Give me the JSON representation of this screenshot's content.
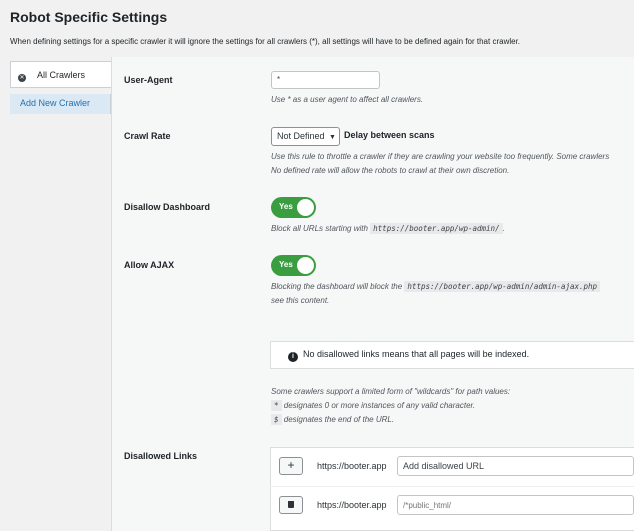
{
  "header": {
    "title": "Robot Specific Settings",
    "description": "When defining settings for a specific crawler it will ignore the settings for all crawlers (*), all settings will have to be defined again for that crawler."
  },
  "sidebar": {
    "items": [
      {
        "label": "All Crawlers",
        "active": true,
        "icon": "close-circle-icon"
      },
      {
        "label": "Add New Crawler",
        "active": false
      }
    ]
  },
  "user_agent": {
    "label": "User-Agent",
    "value": "*",
    "help": "Use * as a user agent to affect all crawlers."
  },
  "crawl_rate": {
    "label": "Crawl Rate",
    "selected": "Not Defined",
    "suffix": "Delay between scans",
    "help_line1": "Use this rule to throttle a crawler if they are crawling your website too frequently. Some crawlers",
    "help_line2": "No defined rate will allow the robots to crawl at their own discretion."
  },
  "disallow_dashboard": {
    "label": "Disallow Dashboard",
    "toggle": "Yes",
    "help_prefix": "Block all URLs starting with",
    "help_code": "https://booter.app/wp-admin/",
    "help_suffix": "."
  },
  "allow_ajax": {
    "label": "Allow AJAX",
    "toggle": "Yes",
    "help_prefix": "Blocking the dashboard will block the",
    "help_code": "https://booter.app/wp-admin/admin-ajax.php",
    "help_line2": "see this content."
  },
  "notice": {
    "text": "No disallowed links means that all pages will be indexed."
  },
  "wildcards": {
    "intro": "Some crawlers support a limited form of \"wildcards\" for path values:",
    "items": [
      {
        "symbol": "*",
        "text": "designates 0 or more instances of any valid character."
      },
      {
        "symbol": "$",
        "text": "designates the end of the URL."
      }
    ]
  },
  "disallowed_links": {
    "label": "Disallowed Links",
    "rows": [
      {
        "button": "+",
        "button_icon": "plus-icon",
        "prefix": "https://booter.app",
        "value": "Add disallowed URL",
        "is_placeholder": false
      },
      {
        "button": "🗑",
        "button_icon": "trash-icon",
        "prefix": "https://booter.app",
        "placeholder": "/*public_html/"
      }
    ]
  },
  "colors": {
    "toggle_on": "#3a9d3f",
    "link": "#2271b1",
    "active_tab_bg": "#dbe9f4"
  }
}
